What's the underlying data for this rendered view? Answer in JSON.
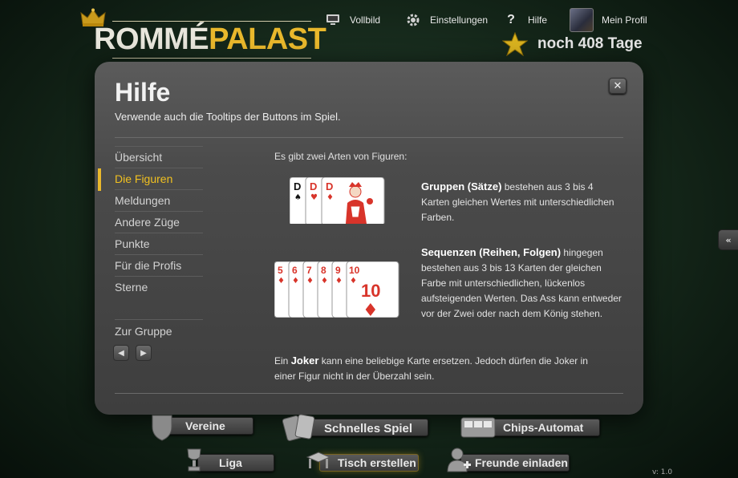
{
  "logo": {
    "romme": "ROMMÉ",
    "palast": "PALAST",
    "sub": "Apps ohne Ende"
  },
  "topnav": {
    "vollbild": "Vollbild",
    "einstellungen": "Einstellungen",
    "hilfe": "Hilfe",
    "profil": "Mein Profil"
  },
  "premium": {
    "days": "noch 408 Tage"
  },
  "modal": {
    "title": "Hilfe",
    "subtitle": "Verwende auch die Tooltips der Buttons im Spiel.",
    "close": "✕",
    "menu": [
      "Übersicht",
      "Die Figuren",
      "Meldungen",
      "Andere Züge",
      "Punkte",
      "Für die Profis",
      "Sterne"
    ],
    "active_index": 1,
    "group": "Zur Gruppe",
    "content": {
      "intro": "Es gibt zwei Arten von Figuren:",
      "gruppen_bold": "Gruppen (Sätze)",
      "gruppen_text": " bestehen aus 3 bis 4 Karten gleichen Wertes mit unterschiedlichen Farben.",
      "sequenzen_bold": "Sequenzen (Reihen, Folgen)",
      "sequenzen_text": " hingegen bestehen aus 3 bis 13 Karten der gleichen Farbe mit unterschiedlichen, lückenlos aufsteigenden Werten. Das Ass kann entweder vor der Zwei oder nach dem König stehen.",
      "joker_pre": "Ein ",
      "joker_bold": "Joker",
      "joker_text": " kann eine beliebige Karte ersetzen. Jedoch dürfen die Joker in einer Figur nicht in der Überzahl sein."
    },
    "cards_gruppen": [
      "D",
      "D",
      "D"
    ],
    "cards_seq": [
      "5",
      "6",
      "7",
      "8",
      "9",
      "10"
    ],
    "cards_seq_big": "10"
  },
  "bottom": {
    "vereine": "Vereine",
    "schnelles_spiel": "Schnelles Spiel",
    "chips": "Chips-Automat",
    "liga": "Liga",
    "tisch": "Tisch erstellen",
    "freunde": "Freunde einladen"
  },
  "version": "v: 1.0",
  "side_tab": "«",
  "colors": {
    "accent": "#e9b82c",
    "card_red": "#d8342a",
    "card_black": "#111111"
  }
}
